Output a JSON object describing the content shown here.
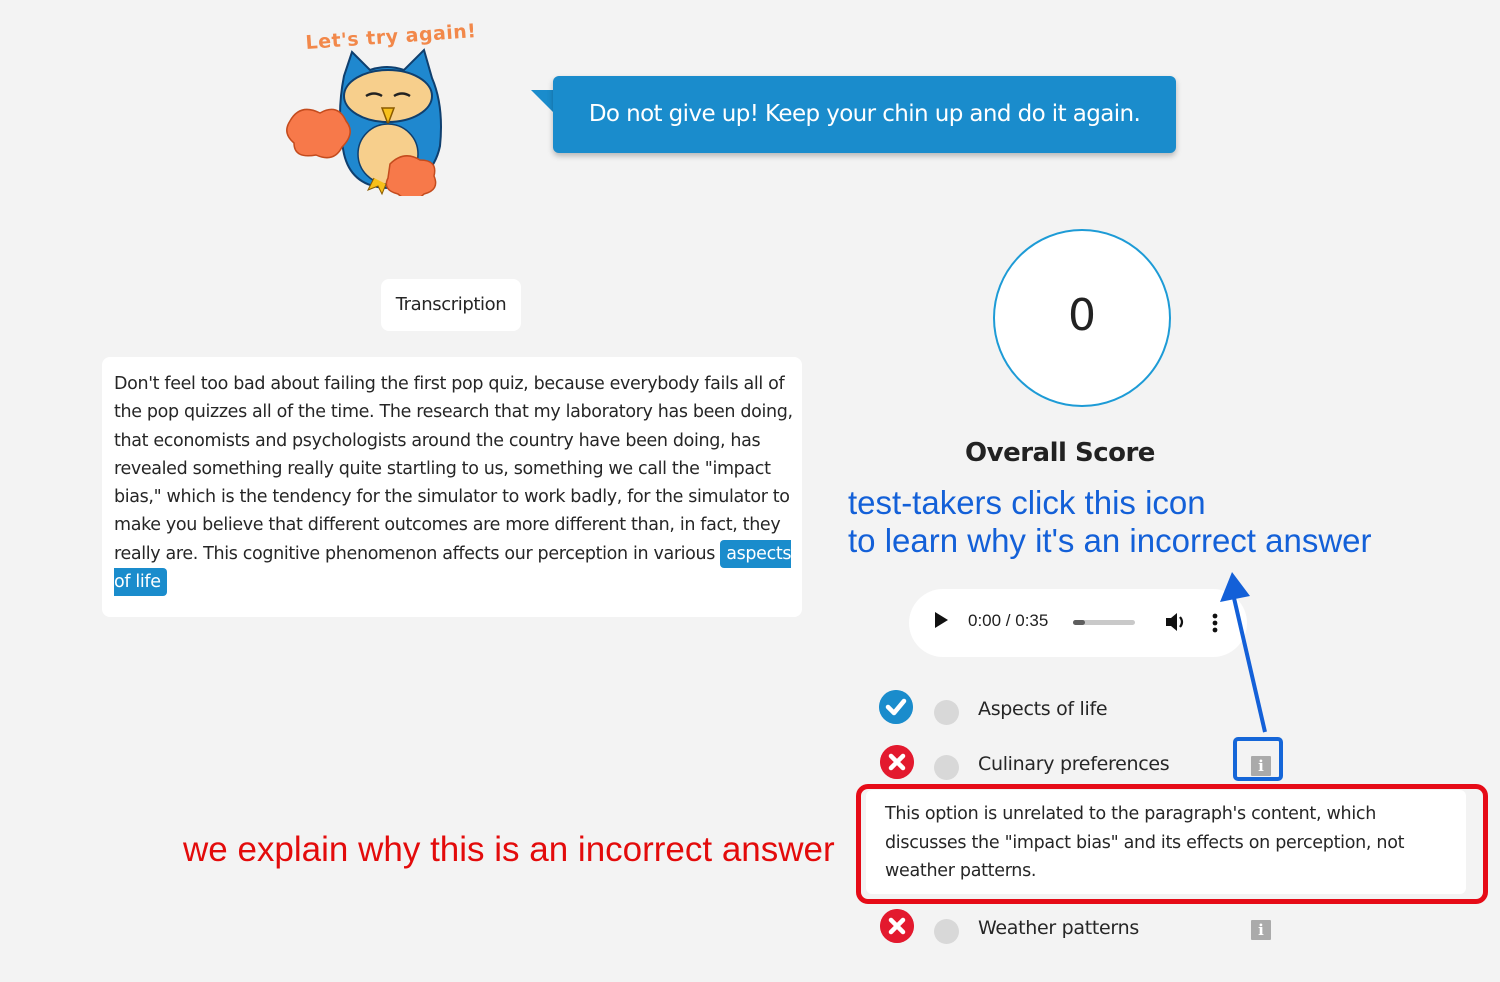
{
  "mascot": {
    "title": "Let's try again!",
    "icon": "owl-mascot"
  },
  "feedback": {
    "message": "Do not give up! Keep your chin up and do it again."
  },
  "transcription": {
    "tab_label": "Transcription",
    "text": "Don't feel too bad about failing the first pop quiz, because everybody fails all of the pop quizzes all of the time. The research that my laboratory has been doing, that economists and psychologists around the country have been doing, has revealed something really quite startling to us, something we call the \"impact bias,\" which is the tendency for the simulator to work badly, for the simulator to make you believe that different outcomes are more different than, in fact, they really are. This cognitive phenomenon affects our perception in various",
    "highlighted_answer": "aspects of life"
  },
  "score": {
    "value": "0",
    "label": "Overall Score"
  },
  "audio_player": {
    "time_display": "0:00 / 0:35",
    "progress_fraction": 0.0,
    "play_icon": "play-icon",
    "volume_icon": "volume-icon",
    "more_icon": "more-vertical-icon"
  },
  "options": [
    {
      "label": "Aspects of life",
      "status": "correct",
      "has_info": false
    },
    {
      "label": "Culinary preferences",
      "status": "incorrect",
      "has_info": true,
      "explanation": "This option is unrelated to the paragraph's content, which discusses the \"impact bias\" and its effects on perception, not weather patterns."
    },
    {
      "label": "Weather patterns",
      "status": "incorrect",
      "has_info": true
    }
  ],
  "annotations": {
    "blue_line1": "test-takers click this icon",
    "blue_line2": "to learn why it's an incorrect answer",
    "red": "we explain why this is an incorrect answer"
  },
  "colors": {
    "brand_blue": "#1a8ccc",
    "incorrect_red": "#e3192e",
    "annotation_blue": "#1360d8",
    "annotation_red": "#e30b0b",
    "background": "#f3f3f3"
  }
}
